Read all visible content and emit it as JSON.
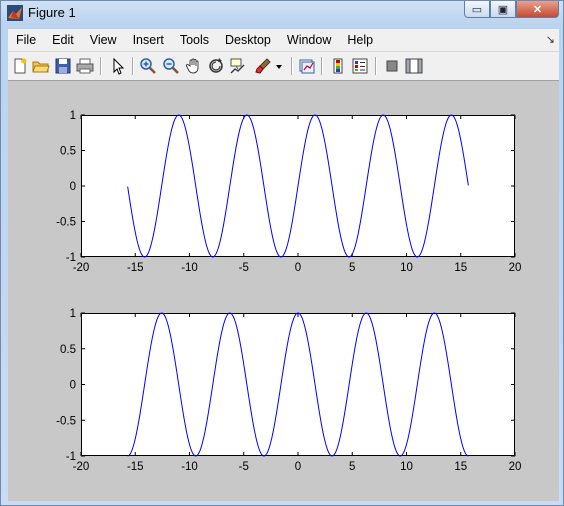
{
  "window": {
    "title": "Figure 1",
    "minimize_symbol": "▭",
    "maximize_symbol": "▣",
    "close_symbol": "✕"
  },
  "menu": {
    "items": [
      "File",
      "Edit",
      "View",
      "Insert",
      "Tools",
      "Desktop",
      "Window",
      "Help"
    ],
    "overflow_arrow": "↘"
  },
  "toolbar": {
    "icons": [
      "new-figure-icon",
      "open-file-icon",
      "save-icon",
      "print-icon",
      "edit-plot-arrow-icon",
      "zoom-in-icon",
      "zoom-out-icon",
      "pan-hand-icon",
      "rotate-3d-icon",
      "data-cursor-icon",
      "brush-icon",
      "brush-dropdown-icon",
      "link-plot-icon",
      "insert-colorbar-icon",
      "insert-legend-icon",
      "hide-plot-tools-icon",
      "show-plot-tools-icon"
    ]
  },
  "chart_data": [
    {
      "type": "line",
      "function": "sin(x)",
      "x_range": [
        -15.7,
        15.7
      ],
      "xlim": [
        -20,
        20
      ],
      "ylim": [
        -1,
        1
      ],
      "xticks": [
        "-20",
        "-15",
        "-10",
        "-5",
        "0",
        "5",
        "10",
        "15",
        "20"
      ],
      "yticks": [
        "1",
        "0.5",
        "0",
        "-0.5",
        "-1"
      ],
      "series": [
        {
          "color": "#0000ff"
        }
      ],
      "grid": false
    },
    {
      "type": "line",
      "function": "cos(x)",
      "x_range": [
        -15.7,
        15.7
      ],
      "xlim": [
        -20,
        20
      ],
      "ylim": [
        -1,
        1
      ],
      "xticks": [
        "-20",
        "-15",
        "-10",
        "-5",
        "0",
        "5",
        "10",
        "15",
        "20"
      ],
      "yticks": [
        "1",
        "0.5",
        "0",
        "-0.5",
        "-1"
      ],
      "series": [
        {
          "color": "#0000ff"
        }
      ],
      "grid": false
    }
  ]
}
